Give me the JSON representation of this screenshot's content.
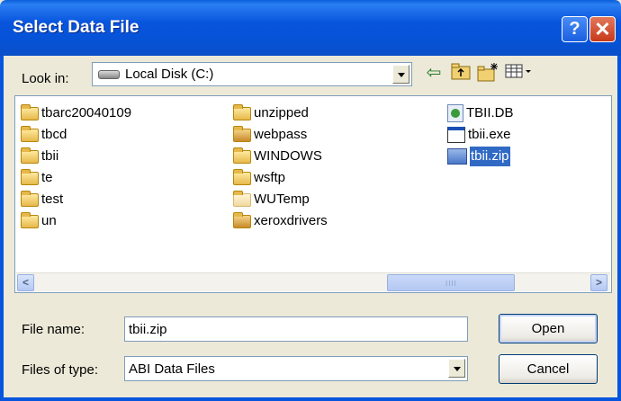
{
  "window": {
    "title": "Select Data File",
    "help_glyph": "?",
    "close_glyph": "✕"
  },
  "look_in": {
    "label": "Look in:",
    "value": "Local Disk (C:)"
  },
  "toolbar": {
    "back_icon": "back-arrow-icon",
    "up_icon": "up-folder-icon",
    "new_folder_icon": "new-folder-icon",
    "view_icon": "view-menu-icon"
  },
  "files": {
    "col1": [
      "tbarc20040109",
      "tbcd",
      "tbii",
      "te",
      "test",
      "un"
    ],
    "col2": [
      "unzipped",
      "webpass",
      "WINDOWS",
      "wsftp",
      "WUTemp",
      "xeroxdrivers"
    ],
    "col3": [
      "TBII.DB",
      "tbii.exe",
      "tbii.zip"
    ],
    "selected": "tbii.zip"
  },
  "scrollbar": {
    "left_glyph": "<",
    "right_glyph": ">",
    "grip": "IIII"
  },
  "file_name": {
    "label": "File name:",
    "value": "tbii.zip"
  },
  "file_type": {
    "label": "Files of type:",
    "value": "ABI Data Files"
  },
  "buttons": {
    "open": "Open",
    "cancel": "Cancel"
  },
  "colors": {
    "titlebar": "#0855dd",
    "selection": "#316ac5",
    "dialog_bg": "#ece9d8"
  }
}
